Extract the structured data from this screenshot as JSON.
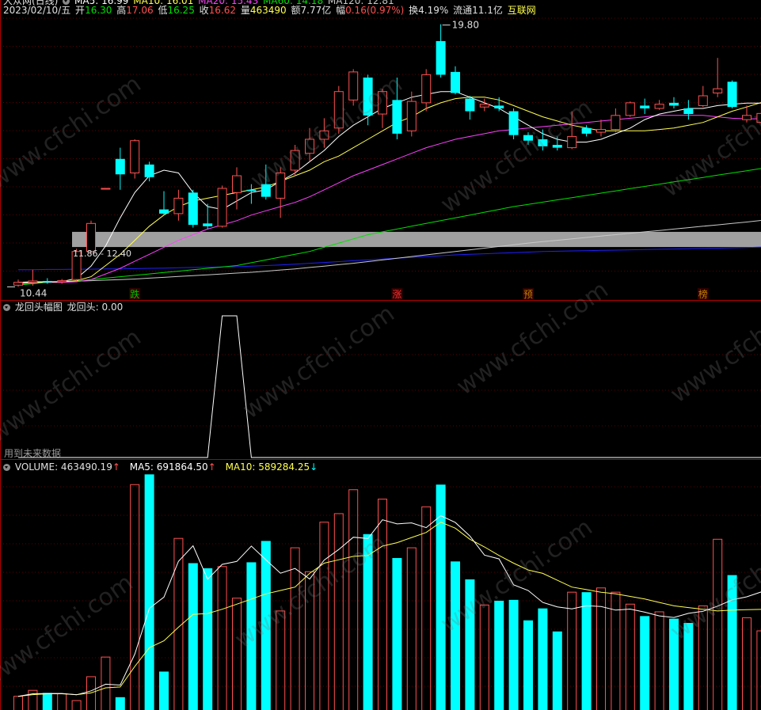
{
  "top_strip": {
    "title": "大众网(日线)",
    "ma5": "MA5: 16.99",
    "ma10": "MA10: 16.01",
    "ma20": "MA20: 15.43",
    "ma60": "MA60: 14.18",
    "ma120": "MA120: 12.81"
  },
  "info_bar": {
    "date": "2023/02/10/五",
    "open_label": "开",
    "open": "16.30",
    "high_label": "高",
    "high": "17.06",
    "low_label": "低",
    "low": "16.25",
    "close_label": "收",
    "close": "16.62",
    "vol_label": "量",
    "vol": "463490",
    "amt_label": "额",
    "amt": "7.77亿",
    "chg_label": "幅",
    "chg": "0.16(0.97%)",
    "turn_label": "换",
    "turn": "4.19%",
    "float_label": "流通",
    "float": "11.1亿",
    "concept": "互联网"
  },
  "annotations": {
    "high_mark": "19.80",
    "low_mark": "10.44",
    "zone_label": "11.86 - 12.40",
    "marker_die": "跌",
    "marker_zhang": "涨",
    "marker_yu": "预",
    "marker_bang": "榜"
  },
  "indicator_panel": {
    "name": "龙回头幅图",
    "value_label": "龙回头: 0.00",
    "footer_note": "用到未来数据"
  },
  "volume_panel": {
    "volume": "VOLUME: 463490.19",
    "ma5": "MA5: 691864.50",
    "ma10": "MA10: 589284.25",
    "up_arrow": "↑",
    "down_arrow": "↓"
  },
  "watermark": "www.cfchi.com",
  "colors": {
    "up": "#ff5050",
    "down": "#00ffff",
    "ma5": "#ffffff",
    "ma10": "#ffff50",
    "ma20": "#ff40ff",
    "ma60": "#00e000",
    "ma120": "#c8c8c8",
    "ma250": "#2020ff",
    "frame": "#b00000",
    "zone": "#a0a0a0"
  },
  "chart_data": {
    "type": "candlestick",
    "price_range": [
      10.0,
      20.1
    ],
    "candles": [
      {
        "o": 10.5,
        "h": 10.7,
        "l": 10.44,
        "c": 10.6
      },
      {
        "o": 10.6,
        "h": 11.05,
        "l": 10.48,
        "c": 10.65
      },
      {
        "o": 10.65,
        "h": 10.75,
        "l": 10.55,
        "c": 10.6
      },
      {
        "o": 10.62,
        "h": 10.72,
        "l": 10.55,
        "c": 10.66
      },
      {
        "o": 10.7,
        "h": 11.8,
        "l": 10.65,
        "c": 11.7
      },
      {
        "o": 11.7,
        "h": 12.8,
        "l": 11.6,
        "c": 12.7
      },
      {
        "o": 13.95,
        "h": 13.95,
        "l": 13.95,
        "c": 13.95
      },
      {
        "o": 15.0,
        "h": 15.4,
        "l": 13.9,
        "c": 14.45
      },
      {
        "o": 14.5,
        "h": 15.7,
        "l": 14.3,
        "c": 15.65
      },
      {
        "o": 14.8,
        "h": 14.9,
        "l": 14.2,
        "c": 14.35
      },
      {
        "o": 13.2,
        "h": 13.85,
        "l": 13.0,
        "c": 13.05
      },
      {
        "o": 13.05,
        "h": 13.9,
        "l": 12.8,
        "c": 13.6
      },
      {
        "o": 13.8,
        "h": 13.9,
        "l": 12.55,
        "c": 12.65
      },
      {
        "o": 12.7,
        "h": 13.4,
        "l": 12.5,
        "c": 12.6
      },
      {
        "o": 12.6,
        "h": 14.05,
        "l": 12.55,
        "c": 13.95
      },
      {
        "o": 13.8,
        "h": 14.7,
        "l": 13.2,
        "c": 14.4
      },
      {
        "o": 13.9,
        "h": 14.1,
        "l": 13.4,
        "c": 13.85
      },
      {
        "o": 14.1,
        "h": 14.8,
        "l": 13.55,
        "c": 13.65
      },
      {
        "o": 13.6,
        "h": 14.7,
        "l": 12.9,
        "c": 14.5
      },
      {
        "o": 14.6,
        "h": 15.5,
        "l": 14.4,
        "c": 15.3
      },
      {
        "o": 15.2,
        "h": 16.1,
        "l": 14.9,
        "c": 15.7
      },
      {
        "o": 15.7,
        "h": 16.45,
        "l": 15.4,
        "c": 16.0
      },
      {
        "o": 16.1,
        "h": 17.6,
        "l": 15.9,
        "c": 17.4
      },
      {
        "o": 17.1,
        "h": 18.2,
        "l": 16.9,
        "c": 18.1
      },
      {
        "o": 17.9,
        "h": 18.0,
        "l": 16.2,
        "c": 16.55
      },
      {
        "o": 16.6,
        "h": 17.5,
        "l": 16.1,
        "c": 17.4
      },
      {
        "o": 17.1,
        "h": 17.9,
        "l": 15.7,
        "c": 15.9
      },
      {
        "o": 16.0,
        "h": 17.4,
        "l": 15.8,
        "c": 17.05
      },
      {
        "o": 17.0,
        "h": 18.2,
        "l": 16.7,
        "c": 18.0
      },
      {
        "o": 19.2,
        "h": 19.8,
        "l": 17.9,
        "c": 18.0
      },
      {
        "o": 18.1,
        "h": 18.3,
        "l": 17.3,
        "c": 17.35
      },
      {
        "o": 17.15,
        "h": 17.25,
        "l": 16.4,
        "c": 16.7
      },
      {
        "o": 16.85,
        "h": 17.15,
        "l": 16.7,
        "c": 16.95
      },
      {
        "o": 16.9,
        "h": 17.2,
        "l": 16.7,
        "c": 16.8
      },
      {
        "o": 16.7,
        "h": 16.8,
        "l": 15.7,
        "c": 15.85
      },
      {
        "o": 15.85,
        "h": 15.95,
        "l": 15.5,
        "c": 15.65
      },
      {
        "o": 15.7,
        "h": 16.05,
        "l": 15.3,
        "c": 15.45
      },
      {
        "o": 15.5,
        "h": 15.8,
        "l": 15.3,
        "c": 15.4
      },
      {
        "o": 15.4,
        "h": 16.7,
        "l": 15.35,
        "c": 15.8
      },
      {
        "o": 16.1,
        "h": 16.2,
        "l": 15.8,
        "c": 15.9
      },
      {
        "o": 15.95,
        "h": 16.4,
        "l": 15.8,
        "c": 16.05
      },
      {
        "o": 16.05,
        "h": 16.8,
        "l": 15.95,
        "c": 16.55
      },
      {
        "o": 16.55,
        "h": 17.05,
        "l": 16.5,
        "c": 17.0
      },
      {
        "o": 16.9,
        "h": 17.15,
        "l": 16.6,
        "c": 16.8
      },
      {
        "o": 16.8,
        "h": 17.1,
        "l": 16.75,
        "c": 16.95
      },
      {
        "o": 17.0,
        "h": 17.2,
        "l": 16.8,
        "c": 16.9
      },
      {
        "o": 16.8,
        "h": 17.1,
        "l": 16.4,
        "c": 16.6
      },
      {
        "o": 16.9,
        "h": 17.6,
        "l": 16.85,
        "c": 17.25
      },
      {
        "o": 17.35,
        "h": 18.6,
        "l": 17.2,
        "c": 17.5
      },
      {
        "o": 17.75,
        "h": 17.8,
        "l": 16.8,
        "c": 16.85
      },
      {
        "o": 16.4,
        "h": 16.9,
        "l": 16.3,
        "c": 16.55
      },
      {
        "o": 16.3,
        "h": 17.06,
        "l": 16.25,
        "c": 16.62
      }
    ],
    "ma5": [
      10.6,
      10.62,
      10.62,
      10.63,
      10.74,
      11.18,
      11.9,
      12.9,
      13.8,
      14.4,
      14.6,
      14.5,
      13.8,
      13.3,
      13.2,
      13.5,
      13.8,
      13.9,
      14.2,
      14.5,
      14.9,
      15.3,
      15.8,
      16.2,
      16.5,
      16.8,
      17.0,
      17.2,
      17.3,
      17.4,
      17.4,
      17.2,
      17.0,
      16.8,
      16.5,
      16.2,
      15.9,
      15.7,
      15.6,
      15.6,
      15.7,
      15.9,
      16.1,
      16.4,
      16.6,
      16.7,
      16.8,
      16.8,
      16.9,
      16.95,
      16.99,
      16.99
    ],
    "ma10": [
      10.6,
      10.6,
      10.61,
      10.62,
      10.66,
      10.8,
      11.2,
      11.6,
      12.1,
      12.6,
      13.0,
      13.3,
      13.5,
      13.6,
      13.7,
      13.8,
      13.9,
      14.0,
      14.2,
      14.4,
      14.6,
      14.9,
      15.1,
      15.4,
      15.7,
      16.0,
      16.3,
      16.5,
      16.8,
      17.0,
      17.15,
      17.2,
      17.2,
      17.1,
      16.9,
      16.7,
      16.5,
      16.35,
      16.2,
      16.1,
      16.0,
      16.0,
      16.0,
      16.0,
      16.05,
      16.1,
      16.2,
      16.3,
      16.5,
      16.7,
      16.85,
      17.01
    ],
    "ma20": [
      10.6,
      10.6,
      10.6,
      10.6,
      10.62,
      10.7,
      10.9,
      11.1,
      11.35,
      11.6,
      11.85,
      12.1,
      12.3,
      12.5,
      12.65,
      12.8,
      13.0,
      13.15,
      13.3,
      13.45,
      13.65,
      13.9,
      14.15,
      14.4,
      14.6,
      14.8,
      15.0,
      15.2,
      15.4,
      15.55,
      15.7,
      15.8,
      15.9,
      16.0,
      16.05,
      16.1,
      16.15,
      16.2,
      16.25,
      16.3,
      16.35,
      16.4,
      16.45,
      16.5,
      16.55,
      16.55,
      16.55,
      16.55,
      16.5,
      16.45,
      16.43,
      16.43
    ],
    "ma60": [
      10.5,
      10.55,
      10.6,
      10.62,
      10.65,
      10.7,
      10.75,
      10.8,
      10.85,
      10.9,
      10.95,
      11.0,
      11.05,
      11.1,
      11.15,
      11.2,
      11.3,
      11.4,
      11.5,
      11.6,
      11.7,
      11.85,
      12.0,
      12.15,
      12.3,
      12.4,
      12.5,
      12.6,
      12.7,
      12.8,
      12.9,
      13.0,
      13.1,
      13.2,
      13.3,
      13.38,
      13.46,
      13.54,
      13.62,
      13.7,
      13.78,
      13.86,
      13.94,
      14.02,
      14.1,
      14.18,
      14.26,
      14.34,
      14.42,
      14.5,
      14.58,
      14.66
    ],
    "ma120": [
      10.55,
      10.58,
      10.6,
      10.62,
      10.64,
      10.66,
      10.68,
      10.7,
      10.72,
      10.75,
      10.78,
      10.81,
      10.84,
      10.87,
      10.9,
      10.93,
      10.96,
      11.0,
      11.04,
      11.08,
      11.13,
      11.18,
      11.23,
      11.28,
      11.34,
      11.4,
      11.46,
      11.52,
      11.58,
      11.64,
      11.7,
      11.76,
      11.82,
      11.88,
      11.94,
      12.0,
      12.05,
      12.1,
      12.15,
      12.2,
      12.25,
      12.3,
      12.35,
      12.4,
      12.45,
      12.5,
      12.55,
      12.6,
      12.65,
      12.7,
      12.75,
      12.81
    ],
    "ma250": [
      11.05,
      11.05,
      11.06,
      11.06,
      11.07,
      11.07,
      11.08,
      11.08,
      11.09,
      11.1,
      11.11,
      11.12,
      11.13,
      11.14,
      11.15,
      11.16,
      11.18,
      11.2,
      11.22,
      11.25,
      11.28,
      11.31,
      11.34,
      11.37,
      11.4,
      11.43,
      11.46,
      11.49,
      11.52,
      11.55,
      11.58,
      11.6,
      11.62,
      11.64,
      11.66,
      11.68,
      11.7,
      11.71,
      11.72,
      11.73,
      11.74,
      11.75,
      11.76,
      11.77,
      11.78,
      11.79,
      11.8,
      11.81,
      11.82,
      11.83,
      11.84,
      11.86
    ],
    "dragon_indicator": [
      0,
      0,
      0,
      0,
      0,
      0,
      0,
      0,
      0,
      0,
      0,
      0,
      0,
      0,
      1,
      1,
      0,
      0,
      0,
      0,
      0,
      0,
      0,
      0,
      0,
      0,
      0,
      0,
      0,
      0,
      0,
      0,
      0,
      0,
      0,
      0,
      0,
      0,
      0,
      0,
      0,
      0,
      0,
      0,
      0,
      0,
      0,
      0,
      0,
      0,
      0,
      0
    ],
    "volume": [
      80000,
      115000,
      100000,
      95000,
      55000,
      195000,
      310000,
      75000,
      1320000,
      1380000,
      225000,
      1005000,
      860000,
      830000,
      840000,
      655000,
      865000,
      990000,
      580000,
      950000,
      810000,
      1100000,
      1150000,
      1290000,
      1030000,
      1235000,
      890000,
      950000,
      1190000,
      1320000,
      870000,
      765000,
      615000,
      640000,
      645000,
      525000,
      595000,
      460000,
      690000,
      690000,
      715000,
      690000,
      620000,
      550000,
      575000,
      535000,
      510000,
      610000,
      1000000,
      790000,
      540000,
      463490
    ],
    "vol_ma5": [
      80000,
      95000,
      97000,
      97000,
      89000,
      112000,
      151000,
      146000,
      327000,
      595000,
      661000,
      871000,
      962000,
      766000,
      853000,
      870000,
      960000,
      880000,
      801000,
      829000,
      767000,
      878000,
      940000,
      1012000,
      1004000,
      1114000,
      1090000,
      1096000,
      1068000,
      1138000,
      1098000,
      1019000,
      907000,
      885000,
      733000,
      700000,
      630000,
      604000,
      592000,
      611000,
      606000,
      585000,
      591000,
      573000,
      551000,
      542000,
      566000,
      578000,
      608000,
      645000,
      663000,
      691864
    ],
    "vol_ma10": [
      80000,
      90000,
      95000,
      95000,
      90000,
      100000,
      130000,
      135000,
      255000,
      365000,
      405000,
      485000,
      560000,
      565000,
      590000,
      620000,
      650000,
      680000,
      700000,
      720000,
      800000,
      860000,
      880000,
      900000,
      905000,
      960000,
      980000,
      1010000,
      1040000,
      1100000,
      1065000,
      1000000,
      955000,
      905000,
      860000,
      820000,
      800000,
      760000,
      720000,
      705000,
      690000,
      680000,
      665000,
      650000,
      630000,
      610000,
      600000,
      590000,
      580000,
      585000,
      588000,
      589284
    ]
  }
}
